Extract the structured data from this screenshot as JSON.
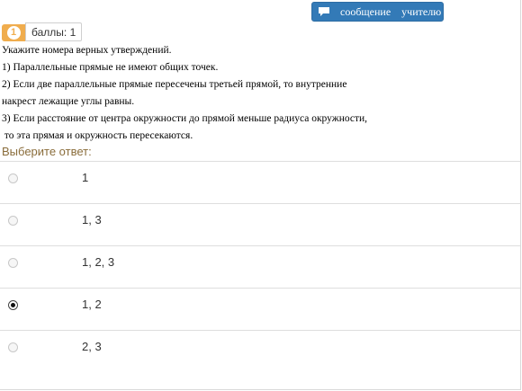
{
  "message_button": {
    "label_part1": "сообщение",
    "label_part2": "учителю",
    "icon": "speech-bubble-icon"
  },
  "question": {
    "number": "1",
    "score_label": "баллы: 1",
    "lines": [
      "Укажите номера верных утверждений.",
      "1) Параллельные прямые не имеют общих точек.",
      "2) Если две параллельные прямые пересечены третьей прямой, то внутренние",
      "накрест лежащие углы равны.",
      "3) Если расстояние от центра окружности до прямой меньше радиуса окружности,",
      " то эта прямая и окружность пересекаются."
    ],
    "prompt": "Выберите ответ:"
  },
  "answers": [
    {
      "label": "1",
      "selected": false
    },
    {
      "label": "1, 3",
      "selected": false
    },
    {
      "label": "1, 2, 3",
      "selected": false
    },
    {
      "label": "1, 2",
      "selected": true
    },
    {
      "label": "2, 3",
      "selected": false
    }
  ],
  "colors": {
    "button_blue": "#337ab7",
    "badge_orange": "#f0ad4e",
    "prompt_brown": "#8a6d3b"
  }
}
